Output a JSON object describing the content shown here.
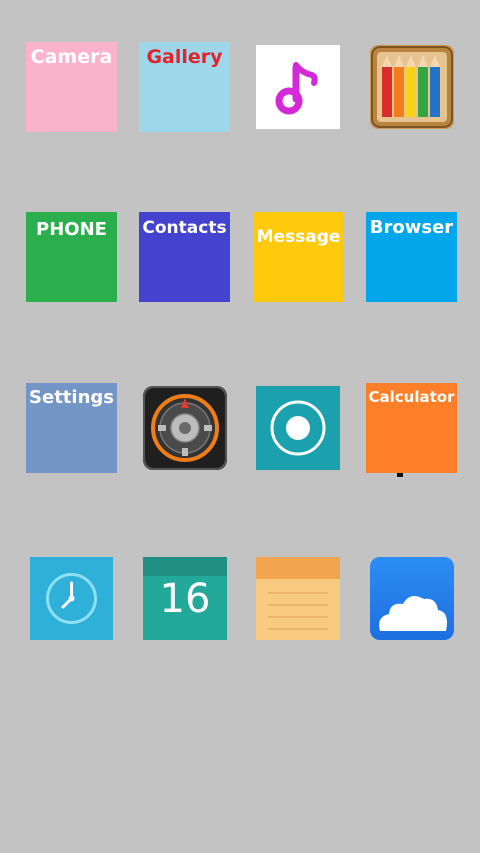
{
  "screen": {
    "background": "#c3c3c3"
  },
  "apps": {
    "camera": {
      "label": "Camera",
      "bg": "#fbb3cc",
      "fg": "#ffffff"
    },
    "gallery": {
      "label": "Gallery",
      "bg": "#9fd7ea",
      "fg": "#e0242a"
    },
    "music": {
      "icon": "music-note-icon",
      "bg": "#ffffff",
      "accent": "#d429d8"
    },
    "pencils": {
      "icon": "colored-pencils-icon"
    },
    "phone": {
      "label": "PHONE",
      "bg": "#2aaf4c",
      "fg": "#ffffff"
    },
    "contacts": {
      "label": "Contacts",
      "bg": "#4343cf",
      "fg": "#ffffff"
    },
    "message": {
      "label": "Message",
      "bg": "#ffc90e",
      "fg": "#ffffff"
    },
    "browser": {
      "label": "Browser",
      "bg": "#03a6ea",
      "fg": "#ffffff"
    },
    "settings": {
      "label": "Settings",
      "bg": "#7396c6",
      "fg": "#ffffff"
    },
    "compass": {
      "icon": "compass-icon"
    },
    "recorder": {
      "icon": "record-icon",
      "bg": "#1ba0ae"
    },
    "calculator": {
      "label": "Calculator",
      "bg": "#fe7f27",
      "fg": "#ffffff"
    },
    "clock": {
      "icon": "clock-icon",
      "bg": "#2eb0d8"
    },
    "calendar": {
      "day": "16",
      "bg": "#22a99a"
    },
    "notes": {
      "icon": "notepad-icon",
      "bg": "#f8ca80"
    },
    "cloud": {
      "icon": "cloud-icon",
      "bg": "#2b86f0"
    }
  }
}
